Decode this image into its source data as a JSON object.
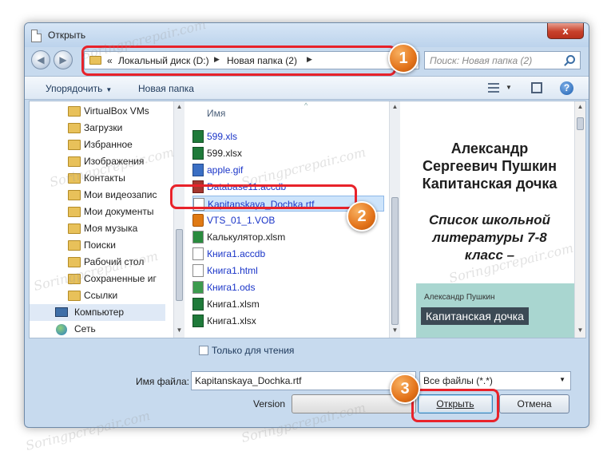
{
  "window": {
    "title": "Открыть",
    "close_label": "x"
  },
  "nav": {
    "back": "◀",
    "forward": "▶"
  },
  "address": {
    "segments": [
      "Локальный диск (D:)",
      "Новая папка (2)"
    ],
    "lead": "«"
  },
  "search": {
    "placeholder": "Поиск: Новая папка (2)"
  },
  "toolbar": {
    "organize": "Упорядочить",
    "new_folder": "Новая папка",
    "help": "?"
  },
  "sidebar": {
    "items": [
      "VirtualBox VMs",
      "Загрузки",
      "Избранное",
      "Изображения",
      "Контакты",
      "Мои видеозапис",
      "Мои документы",
      "Моя музыка",
      "Поиски",
      "Рабочий стол",
      "Сохраненные иг",
      "Ссылки",
      "Компьютер",
      "Сеть"
    ]
  },
  "files": {
    "column": "Имя",
    "items": [
      {
        "name": "599.xls",
        "type": "excel",
        "blue": true
      },
      {
        "name": "599.xlsx",
        "type": "excel",
        "blue": false
      },
      {
        "name": "apple.gif",
        "type": "gif",
        "blue": true
      },
      {
        "name": "Database11.accdb",
        "type": "access",
        "blue": true
      },
      {
        "name": "Kapitanskaya_Dochka.rtf",
        "type": "doc",
        "blue": true
      },
      {
        "name": "VTS_01_1.VOB",
        "type": "vob",
        "blue": true
      },
      {
        "name": "Калькулятор.xlsm",
        "type": "excel",
        "blue": false
      },
      {
        "name": "Книга1.accdb",
        "type": "doc",
        "blue": true
      },
      {
        "name": "Книга1.html",
        "type": "doc",
        "blue": true
      },
      {
        "name": "Книга1.ods",
        "type": "ods",
        "blue": true
      },
      {
        "name": "Книга1.xlsm",
        "type": "excel",
        "blue": false
      },
      {
        "name": "Книга1.xlsx",
        "type": "excel",
        "blue": false
      }
    ]
  },
  "preview": {
    "title_lines": [
      "Александр",
      "Сергеевич Пушкин",
      "Капитанская дочка"
    ],
    "sub_lines": [
      "Список школьной",
      "литературы 7-8",
      "класс –"
    ],
    "cover_author": "Александр Пушкин",
    "cover_title": "Капитанская дочка"
  },
  "bottom": {
    "readonly": "Только для чтения",
    "filename_label": "Имя файла:",
    "filename_value": "Kapitanskaya_Dochka.rtf",
    "filter": "Все файлы (*.*)",
    "version_label": "Version",
    "open": "Открыть",
    "cancel": "Отмена"
  },
  "badges": [
    "1",
    "2",
    "3"
  ],
  "watermark": "Soringpcrepair.com",
  "colors": {
    "highlight": "#e8222a",
    "badge": "#e3731a"
  }
}
